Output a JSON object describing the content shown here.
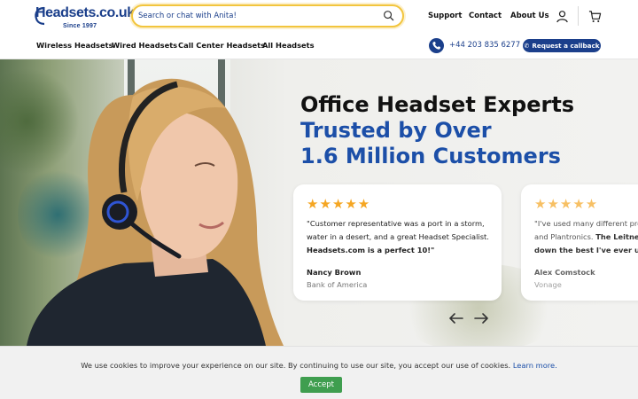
{
  "brand": {
    "logo_text": "Headsets.co.uk",
    "since": "Since 1997",
    "primary_color": "#1b3f8b",
    "accent_color": "#1c4fa8",
    "star_color": "#f5a623",
    "search_border_color": "#f2c53d",
    "accept_color": "#3f9e4f"
  },
  "search": {
    "placeholder": "Search or chat with Anita!",
    "icon": "search-icon"
  },
  "top_links": [
    "Support",
    "Contact",
    "About Us"
  ],
  "header_icons": [
    "user-icon",
    "cart-icon"
  ],
  "nav": [
    "Wireless Headsets",
    "Wired Headsets",
    "Call Center Headsets",
    "All Headsets"
  ],
  "contact": {
    "phone": "+44 203 835 6277",
    "callback_label": "Request a callback",
    "phone_icon": "phone-icon"
  },
  "hero": {
    "title_line1": "Office Headset Experts",
    "title_line2": "Trusted by Over",
    "title_line3": "1.6 Million Customers"
  },
  "reviews": [
    {
      "stars": "★★★★★",
      "quote_part1": "\"Customer representative was a port in a storm, water in a desert, and a great Headset Specialist. ",
      "quote_bold": "Headsets.com is a perfect 10!",
      "quote_end": "\"",
      "name": "Nancy Brown",
      "company": "Bank of America"
    },
    {
      "stars": "★★★★★",
      "line1": "\"I've used many different pro",
      "line2_normal": "and Plantronics. ",
      "line2_bold": "The Leitner h",
      "line3_bold": "down the best I've ever used.\"",
      "name": "Alex Comstock",
      "company": "Vonage"
    }
  ],
  "carousel": {
    "prev_icon": "arrow-left-icon",
    "next_icon": "arrow-right-icon"
  },
  "cookie": {
    "text": "We use cookies to improve your experience on our site. By continuing to use our site, you accept our use of cookies. ",
    "link": "Learn more.",
    "accept_label": "Accept"
  }
}
